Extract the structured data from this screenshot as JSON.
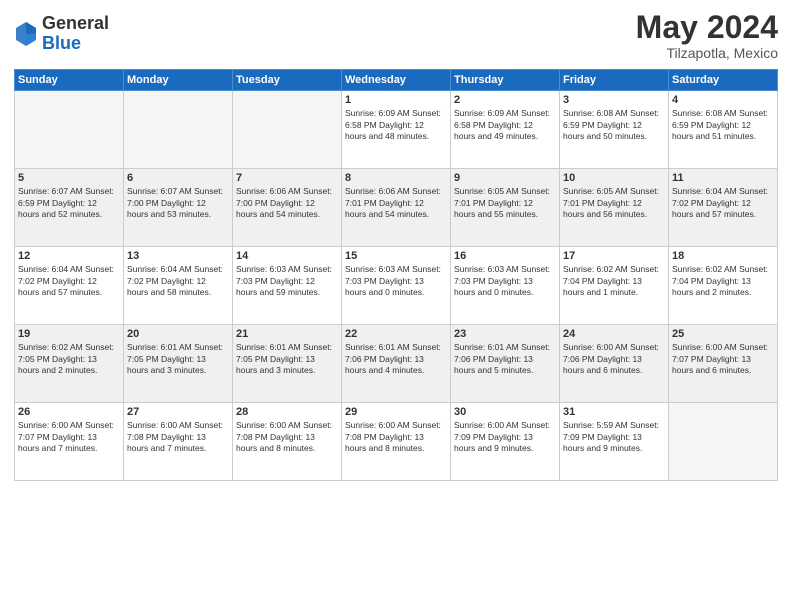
{
  "header": {
    "logo_general": "General",
    "logo_blue": "Blue",
    "month": "May 2024",
    "location": "Tilzapotla, Mexico"
  },
  "days_of_week": [
    "Sunday",
    "Monday",
    "Tuesday",
    "Wednesday",
    "Thursday",
    "Friday",
    "Saturday"
  ],
  "weeks": [
    [
      {
        "num": "",
        "info": ""
      },
      {
        "num": "",
        "info": ""
      },
      {
        "num": "",
        "info": ""
      },
      {
        "num": "1",
        "info": "Sunrise: 6:09 AM\nSunset: 6:58 PM\nDaylight: 12 hours\nand 48 minutes."
      },
      {
        "num": "2",
        "info": "Sunrise: 6:09 AM\nSunset: 6:58 PM\nDaylight: 12 hours\nand 49 minutes."
      },
      {
        "num": "3",
        "info": "Sunrise: 6:08 AM\nSunset: 6:59 PM\nDaylight: 12 hours\nand 50 minutes."
      },
      {
        "num": "4",
        "info": "Sunrise: 6:08 AM\nSunset: 6:59 PM\nDaylight: 12 hours\nand 51 minutes."
      }
    ],
    [
      {
        "num": "5",
        "info": "Sunrise: 6:07 AM\nSunset: 6:59 PM\nDaylight: 12 hours\nand 52 minutes."
      },
      {
        "num": "6",
        "info": "Sunrise: 6:07 AM\nSunset: 7:00 PM\nDaylight: 12 hours\nand 53 minutes."
      },
      {
        "num": "7",
        "info": "Sunrise: 6:06 AM\nSunset: 7:00 PM\nDaylight: 12 hours\nand 54 minutes."
      },
      {
        "num": "8",
        "info": "Sunrise: 6:06 AM\nSunset: 7:01 PM\nDaylight: 12 hours\nand 54 minutes."
      },
      {
        "num": "9",
        "info": "Sunrise: 6:05 AM\nSunset: 7:01 PM\nDaylight: 12 hours\nand 55 minutes."
      },
      {
        "num": "10",
        "info": "Sunrise: 6:05 AM\nSunset: 7:01 PM\nDaylight: 12 hours\nand 56 minutes."
      },
      {
        "num": "11",
        "info": "Sunrise: 6:04 AM\nSunset: 7:02 PM\nDaylight: 12 hours\nand 57 minutes."
      }
    ],
    [
      {
        "num": "12",
        "info": "Sunrise: 6:04 AM\nSunset: 7:02 PM\nDaylight: 12 hours\nand 57 minutes."
      },
      {
        "num": "13",
        "info": "Sunrise: 6:04 AM\nSunset: 7:02 PM\nDaylight: 12 hours\nand 58 minutes."
      },
      {
        "num": "14",
        "info": "Sunrise: 6:03 AM\nSunset: 7:03 PM\nDaylight: 12 hours\nand 59 minutes."
      },
      {
        "num": "15",
        "info": "Sunrise: 6:03 AM\nSunset: 7:03 PM\nDaylight: 13 hours\nand 0 minutes."
      },
      {
        "num": "16",
        "info": "Sunrise: 6:03 AM\nSunset: 7:03 PM\nDaylight: 13 hours\nand 0 minutes."
      },
      {
        "num": "17",
        "info": "Sunrise: 6:02 AM\nSunset: 7:04 PM\nDaylight: 13 hours\nand 1 minute."
      },
      {
        "num": "18",
        "info": "Sunrise: 6:02 AM\nSunset: 7:04 PM\nDaylight: 13 hours\nand 2 minutes."
      }
    ],
    [
      {
        "num": "19",
        "info": "Sunrise: 6:02 AM\nSunset: 7:05 PM\nDaylight: 13 hours\nand 2 minutes."
      },
      {
        "num": "20",
        "info": "Sunrise: 6:01 AM\nSunset: 7:05 PM\nDaylight: 13 hours\nand 3 minutes."
      },
      {
        "num": "21",
        "info": "Sunrise: 6:01 AM\nSunset: 7:05 PM\nDaylight: 13 hours\nand 3 minutes."
      },
      {
        "num": "22",
        "info": "Sunrise: 6:01 AM\nSunset: 7:06 PM\nDaylight: 13 hours\nand 4 minutes."
      },
      {
        "num": "23",
        "info": "Sunrise: 6:01 AM\nSunset: 7:06 PM\nDaylight: 13 hours\nand 5 minutes."
      },
      {
        "num": "24",
        "info": "Sunrise: 6:00 AM\nSunset: 7:06 PM\nDaylight: 13 hours\nand 6 minutes."
      },
      {
        "num": "25",
        "info": "Sunrise: 6:00 AM\nSunset: 7:07 PM\nDaylight: 13 hours\nand 6 minutes."
      }
    ],
    [
      {
        "num": "26",
        "info": "Sunrise: 6:00 AM\nSunset: 7:07 PM\nDaylight: 13 hours\nand 7 minutes."
      },
      {
        "num": "27",
        "info": "Sunrise: 6:00 AM\nSunset: 7:08 PM\nDaylight: 13 hours\nand 7 minutes."
      },
      {
        "num": "28",
        "info": "Sunrise: 6:00 AM\nSunset: 7:08 PM\nDaylight: 13 hours\nand 8 minutes."
      },
      {
        "num": "29",
        "info": "Sunrise: 6:00 AM\nSunset: 7:08 PM\nDaylight: 13 hours\nand 8 minutes."
      },
      {
        "num": "30",
        "info": "Sunrise: 6:00 AM\nSunset: 7:09 PM\nDaylight: 13 hours\nand 9 minutes."
      },
      {
        "num": "31",
        "info": "Sunrise: 5:59 AM\nSunset: 7:09 PM\nDaylight: 13 hours\nand 9 minutes."
      },
      {
        "num": "",
        "info": ""
      }
    ]
  ]
}
